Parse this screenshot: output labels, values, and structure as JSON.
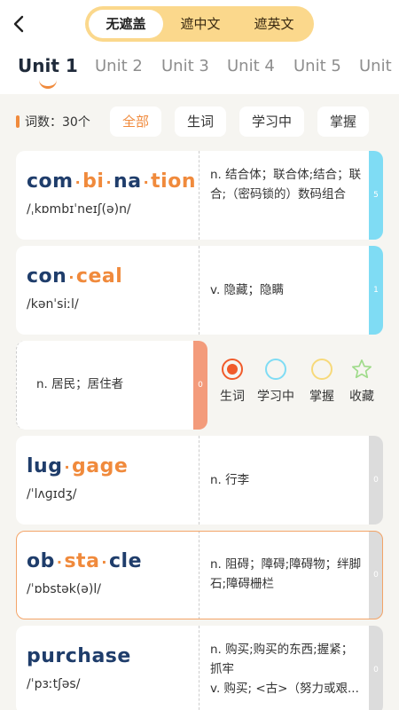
{
  "header": {
    "back_icon": "chevron-left-icon",
    "modes": [
      "无遮盖",
      "遮中文",
      "遮英文"
    ],
    "active_mode": 0
  },
  "units": [
    "Unit 1",
    "Unit 2",
    "Unit 3",
    "Unit 4",
    "Unit 5",
    "Unit"
  ],
  "filter": {
    "count_label": "词数：30个",
    "chips": [
      "全部",
      "生词",
      "学习中",
      "掌握"
    ]
  },
  "words": [
    {
      "syllables": [
        "com",
        "bi",
        "na",
        "tion"
      ],
      "phonetic": "/ˌkɒmbɪˈneɪʃ(ə)n/",
      "definitions": [
        "n. 结合体；联合体;结合；联合;（密码锁的）数码组合"
      ],
      "count": "5",
      "tab_color": "#7fdcf4"
    },
    {
      "syllables": [
        "con",
        "ceal"
      ],
      "phonetic": "/kənˈsiːl/",
      "definitions": [
        "v. 隐藏；隐瞒"
      ],
      "count": "1",
      "tab_color": "#7fdcf4"
    },
    {
      "definitions": [
        "n. 居民；居住者"
      ],
      "count": "0",
      "tab_color": "#f39b7b",
      "actions": [
        {
          "label": "生词",
          "icon": "radio-selected-icon",
          "color": "#f05a2a"
        },
        {
          "label": "学习中",
          "icon": "circle-outline-icon",
          "color": "#7fdcf4"
        },
        {
          "label": "掌握",
          "icon": "circle-outline-icon",
          "color": "#f7d97a"
        },
        {
          "label": "收藏",
          "icon": "star-outline-icon",
          "color": "#9fdb8a"
        }
      ]
    },
    {
      "syllables": [
        "lug",
        "gage"
      ],
      "phonetic": "/ˈlʌɡɪdʒ/",
      "definitions": [
        "n. 行李"
      ],
      "count": "0",
      "tab_color": "#dcdcdc"
    },
    {
      "syllables": [
        "ob",
        "sta",
        "cle"
      ],
      "phonetic": "/ˈɒbstək(ə)l/",
      "definitions": [
        "n. 阻碍；障碍;障碍物；绊脚石;障碍栅栏"
      ],
      "count": "0",
      "tab_color": "#dcdcdc",
      "selected": true
    },
    {
      "syllables": [
        "purchase"
      ],
      "phonetic": "/ˈpɜːtʃəs/",
      "definitions": [
        "n. 购买;购买的东西;握紧；抓牢",
        "v. 购买; <古>（努力或艰..."
      ],
      "count": "0",
      "tab_color": "#dcdcdc"
    }
  ]
}
